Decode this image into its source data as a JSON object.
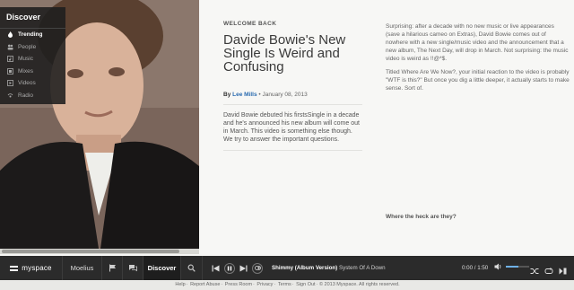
{
  "discover_menu": {
    "title": "Discover",
    "items": [
      {
        "label": "Trending",
        "icon": "flame-icon",
        "active": true
      },
      {
        "label": "People",
        "icon": "people-icon",
        "active": false
      },
      {
        "label": "Music",
        "icon": "music-icon",
        "active": false
      },
      {
        "label": "Mixes",
        "icon": "mixes-icon",
        "active": false
      },
      {
        "label": "Videos",
        "icon": "video-icon",
        "active": false
      },
      {
        "label": "Radio",
        "icon": "radio-icon",
        "active": false
      }
    ]
  },
  "article": {
    "kicker": "WELCOME BACK",
    "title": "Davide Bowie's New Single Is Weird and Confusing",
    "by": "By",
    "author": "Lee Mills",
    "date": "• January 08, 2013",
    "summary": "David Bowie debuted his firstsSingle in a decade and he's announced his new album will come out in March. This video is something else though. We try to answer the important questions."
  },
  "side": {
    "p1": "Surprising: after a decade with no new music or live appearances (save a hilarious cameo on Extras), David Bowie comes out of nowhere with a new single/music video and the announcement that a new album, The Next Day, will drop in March. Not surprising: the music video is weird as !!@*$.",
    "p2": "Titled Where Are We Now?, your initial reaction to the video is probably \"WTF is this?\" But once you dig a little deeper, it actually starts to make sense. Sort of.",
    "question": "Where the heck are they?"
  },
  "player": {
    "logo": "myspace",
    "user": "Moelius",
    "discover": "Discover",
    "track_title": "Shimmy (Album Version)",
    "artist": "System Of A Down",
    "time": "0:00 / 1:50",
    "volume": 0.55
  },
  "footer": {
    "links": [
      "Help",
      "Report Abuse",
      "Press Room",
      "Privacy",
      "Terms",
      "Sign Out"
    ],
    "copyright": "© 2013 Myspace. All rights reserved."
  },
  "colors": {
    "link": "#2a6bb0",
    "player_bg": "#2b2b2b",
    "volume": "#6fb0e6"
  }
}
